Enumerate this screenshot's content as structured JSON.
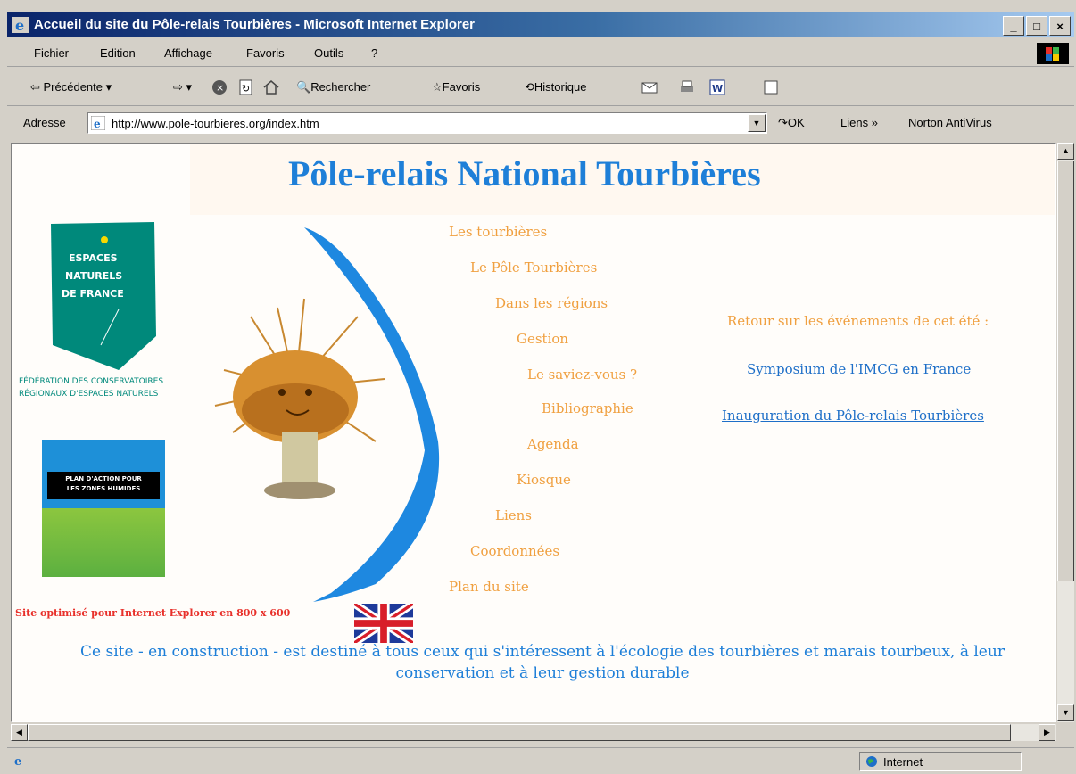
{
  "window": {
    "title": "Accueil du site du Pôle-relais Tourbières - Microsoft Internet Explorer"
  },
  "menu": [
    "Fichier",
    "Edition",
    "Affichage",
    "Favoris",
    "Outils",
    "?"
  ],
  "toolbar": {
    "back": "Précédente",
    "search": "Rechercher",
    "favorites": "Favoris",
    "history": "Historique"
  },
  "address": {
    "label": "Adresse",
    "url": "http://www.pole-tourbieres.org/index.htm",
    "go": "OK",
    "links": "Liens »",
    "norton": "Norton AntiVirus"
  },
  "page": {
    "title": "Pôle-relais National Tourbières",
    "logo1": [
      "ESPACES",
      "NATURELS",
      "DE FRANCE"
    ],
    "logo1_caption": [
      "FÉDÉRATION DES CONSERVATOIRES",
      "RÉGIONAUX D'ESPACES NATURELS"
    ],
    "logo2_caption": [
      "PLAN D'ACTION POUR",
      "LES ZONES HUMIDES"
    ],
    "nav": [
      "Les tourbières",
      "Le Pôle Tourbières",
      "Dans les régions",
      "Gestion",
      "Le saviez-vous ?",
      "Bibliographie",
      "Agenda",
      "Kiosque",
      "Liens",
      "Coordonnées",
      "Plan du site"
    ],
    "retour": "Retour sur les événements de cet été :",
    "links": [
      "Symposium de l'IMCG en France",
      "Inauguration du Pôle-relais Tourbières"
    ],
    "optimized": "Site optimisé pour Internet Explorer en 800 x 600",
    "description": "Ce site - en construction - est destiné à tous ceux qui s'intéressent à l'écologie des tourbières et marais tourbeux, à leur conservation et à leur gestion durable"
  },
  "status": {
    "zone": "Internet"
  },
  "colors": {
    "title_blue": "#1e7fd8",
    "nav_orange": "#f0a040",
    "link_blue": "#1e6fc8",
    "red": "#e8302a"
  }
}
